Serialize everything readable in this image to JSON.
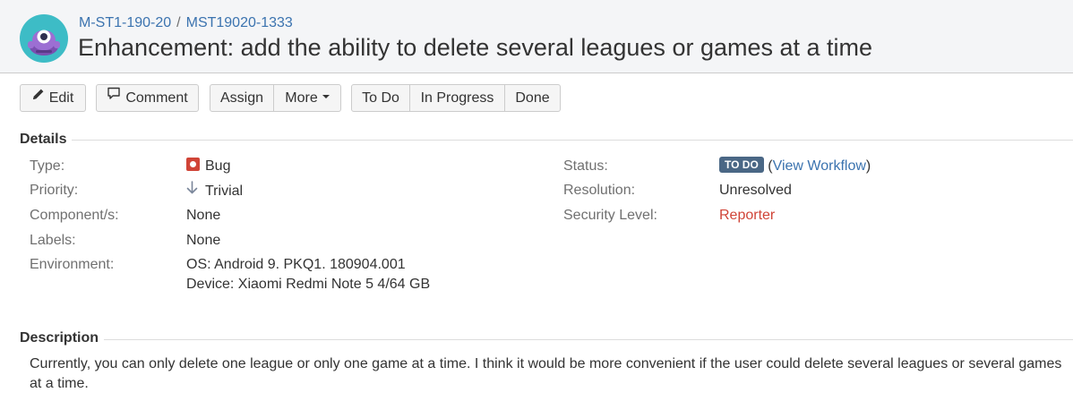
{
  "header": {
    "breadcrumb": {
      "project": "M-ST1-190-20",
      "separator": "/",
      "issue_key": "MST19020-1333"
    },
    "title": "Enhancement: add the ability to delete several leagues or games at a time",
    "avatar_icon": "project-avatar-icon"
  },
  "toolbar": {
    "edit": "Edit",
    "comment": "Comment",
    "assign": "Assign",
    "more": "More",
    "todo": "To Do",
    "in_progress": "In Progress",
    "done": "Done"
  },
  "details": {
    "heading": "Details",
    "left": [
      {
        "label": "Type:",
        "value": "Bug",
        "icon": "bug-icon"
      },
      {
        "label": "Priority:",
        "value": "Trivial",
        "icon": "arrow-down-icon"
      },
      {
        "label": "Component/s:",
        "value": "None"
      },
      {
        "label": "Labels:",
        "value": "None"
      },
      {
        "label": "Environment:",
        "value": "OS: Android 9. PKQ1. 180904.001",
        "value2": "Device: Xiaomi Redmi Note 5 4/64 GB"
      }
    ],
    "right": [
      {
        "label": "Status:",
        "badge": "TO DO",
        "link_open": "(",
        "link": "View Workflow",
        "link_close": ")"
      },
      {
        "label": "Resolution:",
        "value": "Unresolved"
      },
      {
        "label": "Security Level:",
        "value": "Reporter"
      }
    ]
  },
  "description": {
    "heading": "Description",
    "text": "Currently, you can only delete one league or only one game at a time. I think it would be more convenient if the user could delete several leagues or several games at a time."
  },
  "colors": {
    "link": "#3b73af",
    "bug": "#d04437",
    "status_badge": "#4a6785",
    "reporter": "#d04437",
    "header_bg": "#f4f5f7"
  }
}
